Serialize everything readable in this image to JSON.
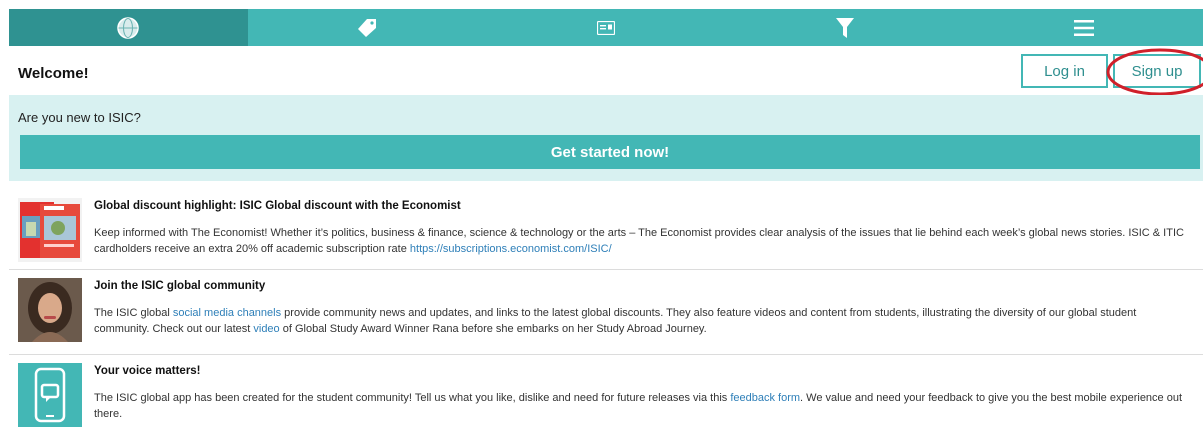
{
  "nav": {
    "items": [
      {
        "name": "globe-logo-icon",
        "active": true
      },
      {
        "name": "discount-tag-icon",
        "active": false
      },
      {
        "name": "id-card-icon",
        "active": false
      },
      {
        "name": "filter-icon",
        "active": false
      },
      {
        "name": "hamburger-menu-icon",
        "active": false
      }
    ]
  },
  "welcome": {
    "title": "Welcome!",
    "login_label": "Log in",
    "signup_label": "Sign up"
  },
  "promo": {
    "question": "Are you new to ISIC?",
    "cta_label": "Get started now!"
  },
  "feed": [
    {
      "title": "Global discount highlight: ISIC Global discount with the Economist",
      "body_before": "Keep informed with The Economist! Whether it’s politics, business & finance, science & technology or the arts – The Economist provides clear analysis of the issues that lie behind each week’s global news stories. ISIC & ITIC cardholders receive an extra 20% off academic subscription rate ",
      "link": "https://subscriptions.economist.com/ISIC/",
      "body_after": "",
      "thumb": "economist-magazine-thumbnail"
    },
    {
      "title": "Join the ISIC global community",
      "body_before": "The ISIC global ",
      "link": "social media channels",
      "body_mid": " provide community news and updates, and links to the latest global discounts. They also feature videos and content from students, illustrating the diversity of our global student community. Check out our latest ",
      "link2": "video",
      "body_after": " of Global Study Award Winner Rana before she embarks on her Study Abroad Journey.",
      "thumb": "student-portrait-thumbnail"
    },
    {
      "title": "Your voice matters!",
      "body_before": "The ISIC global app has been created for the student community! Tell us what you like, dislike and need for future releases via this ",
      "link": "feedback form",
      "body_after": ". We value and need your feedback to give you the best mobile experience out there.",
      "thumb": "phone-chat-thumbnail"
    }
  ],
  "colors": {
    "teal": "#43b7b5",
    "teal_dark": "#2f9291",
    "promo_bg": "#d8f1f1",
    "link": "#2e7fb8",
    "annotation_red": "#d0202a"
  }
}
